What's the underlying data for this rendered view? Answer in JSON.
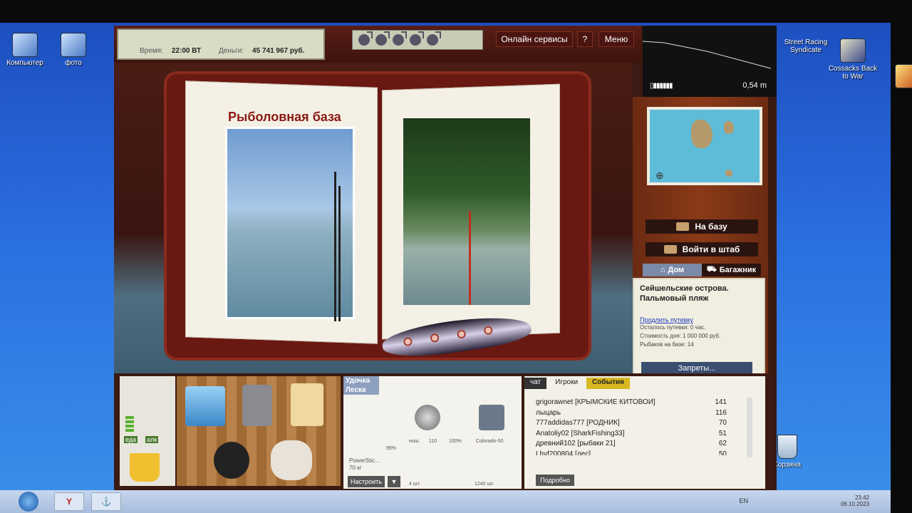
{
  "desktop": {
    "icons": [
      {
        "label": "Компьютер",
        "icon": "computer-icon"
      },
      {
        "label": "фото",
        "icon": "folder-shortcut-icon"
      },
      {
        "label": "Street Racing Syndicate",
        "icon": "game-icon"
      },
      {
        "label": "Cossacks Back to War",
        "icon": "game-icon"
      },
      {
        "label": "Корзина",
        "icon": "recycle-bin-icon"
      }
    ]
  },
  "game": {
    "status": {
      "time_label": "Время:",
      "time_value": "22:00 ВТ",
      "money_label": "Деньги:",
      "money_value": "45 741 967 руб."
    },
    "fish_count_icons": 5,
    "top_buttons": {
      "online": "Онлайн сервисы",
      "help": "?",
      "menu": "Меню"
    },
    "depth": {
      "value": "0,54 m"
    },
    "book": {
      "title": "Рыболовная база"
    },
    "sidebar": {
      "to_base": "На базу",
      "enter_hq": "Войти в штаб",
      "tab_home": "Дом",
      "tab_trunk": "Багажник",
      "location_title": "Сейшельские острова. Пальмовый пляж",
      "extend_link": "Продлить путевку",
      "remaining": "Осталось путевки: 0 час.",
      "day_cost": "Стоимость дня: 1 000 000 руб.",
      "fishers": "Рыбаков на базе: 14",
      "bans_button": "Запреты..."
    },
    "inventory": {
      "food_label": "еда",
      "alc_label": "алк",
      "food_level_pct": 80
    },
    "tackle": {
      "rod_label": "Удочка",
      "line_label": "Леска",
      "rod_name": "PowerStic...",
      "rod_weight": "70 кг",
      "rod_pct": "99%",
      "reel_wear": "нош.",
      "reel_count": "110",
      "reel_pct": "100%",
      "line_name": "Colorado-50",
      "hooks_count": "4 шт.",
      "bait_count": "1240 шт.",
      "configure_button": "Настроить",
      "dropdown_arrow": "▼"
    },
    "chat": {
      "tabs": [
        "чат",
        "Игроки",
        "События"
      ],
      "players": [
        {
          "name": "grigorawnet [КРЫМСКИЕ КИТОВОИ]",
          "score": "141"
        },
        {
          "name": "лыцарь",
          "score": "116"
        },
        {
          "name": "777addidas777 [РОДНИК]",
          "score": "70"
        },
        {
          "name": "Anatoliy02 [SharkFishing33]",
          "score": "51"
        },
        {
          "name": "древний102 [рыбаки 21]",
          "score": "62"
        },
        {
          "name": "Lhvf200804 [лес]",
          "score": "50"
        }
      ],
      "details_button": "Подробно"
    }
  },
  "taskbar": {
    "lang": "EN",
    "time": "23:42",
    "date": "06.10.2023"
  }
}
